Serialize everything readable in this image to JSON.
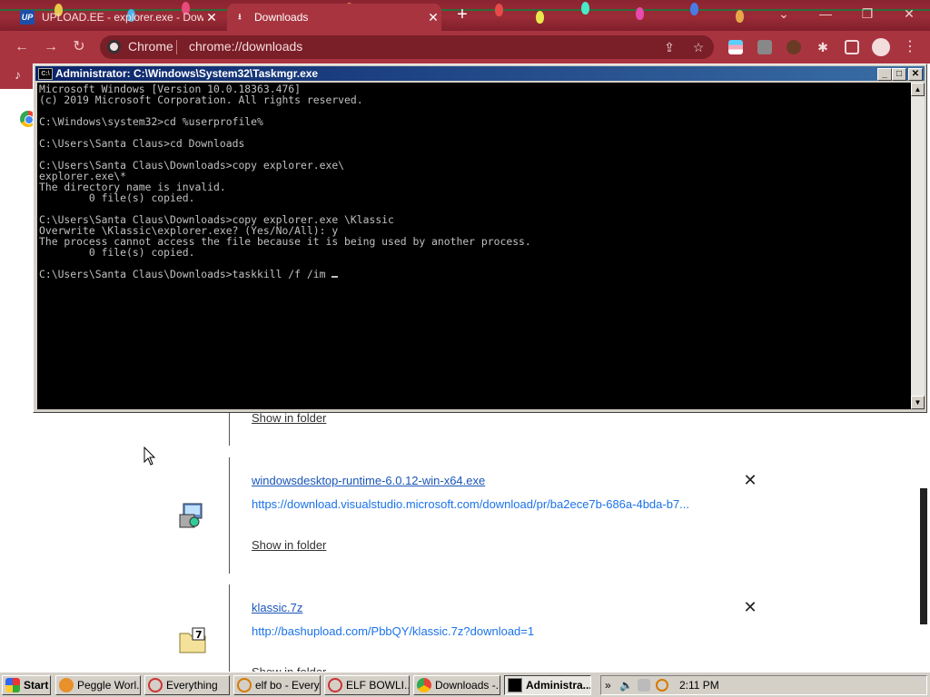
{
  "browser": {
    "tabs": [
      {
        "title": "UPLOAD.EE - explorer.exe - Downl",
        "favicon": "upload-ee-icon",
        "active": false
      },
      {
        "title": "Downloads",
        "favicon": "download-icon",
        "active": true
      }
    ],
    "omnibox": {
      "chip_label": "Chrome",
      "url": "chrome://downloads"
    }
  },
  "console": {
    "title": "Administrator: C:\\Windows\\System32\\Taskmgr.exe",
    "output": "Microsoft Windows [Version 10.0.18363.476]\n(c) 2019 Microsoft Corporation. All rights reserved.\n\nC:\\Windows\\system32>cd %userprofile%\n\nC:\\Users\\Santa Claus>cd Downloads\n\nC:\\Users\\Santa Claus\\Downloads>copy explorer.exe\\\nexplorer.exe\\*\nThe directory name is invalid.\n        0 file(s) copied.\n\nC:\\Users\\Santa Claus\\Downloads>copy explorer.exe \\Klassic\nOverwrite \\Klassic\\explorer.exe? (Yes/No/All): y\nThe process cannot access the file because it is being used by another process.\n        0 file(s) copied.\n\nC:\\Users\\Santa Claus\\Downloads>taskkill /f /im "
  },
  "downloads": {
    "show_in_folder": "Show in folder",
    "items": [
      {
        "name": "windowsdesktop-runtime-6.0.12-win-x64.exe",
        "url": "https://download.visualstudio.microsoft.com/download/pr/ba2ece7b-686a-4bda-b7...",
        "show": "Show in folder"
      },
      {
        "name": "klassic.7z",
        "url": "http://bashupload.com/PbbQY/klassic.7z?download=1",
        "show": "Show in folder"
      }
    ]
  },
  "taskbar": {
    "start": "Start",
    "buttons": [
      {
        "label": "Peggle Worl...",
        "icon": "peggle-icon"
      },
      {
        "label": "Everything",
        "icon": "everything-icon"
      },
      {
        "label": "elf bo - Every...",
        "icon": "search-icon"
      },
      {
        "label": "ELF BOWLI...",
        "icon": "everything-icon"
      },
      {
        "label": "Downloads -...",
        "icon": "chrome-icon"
      },
      {
        "label": "Administra...",
        "icon": "console-icon",
        "active": true
      }
    ],
    "clock": "2:11 PM"
  }
}
